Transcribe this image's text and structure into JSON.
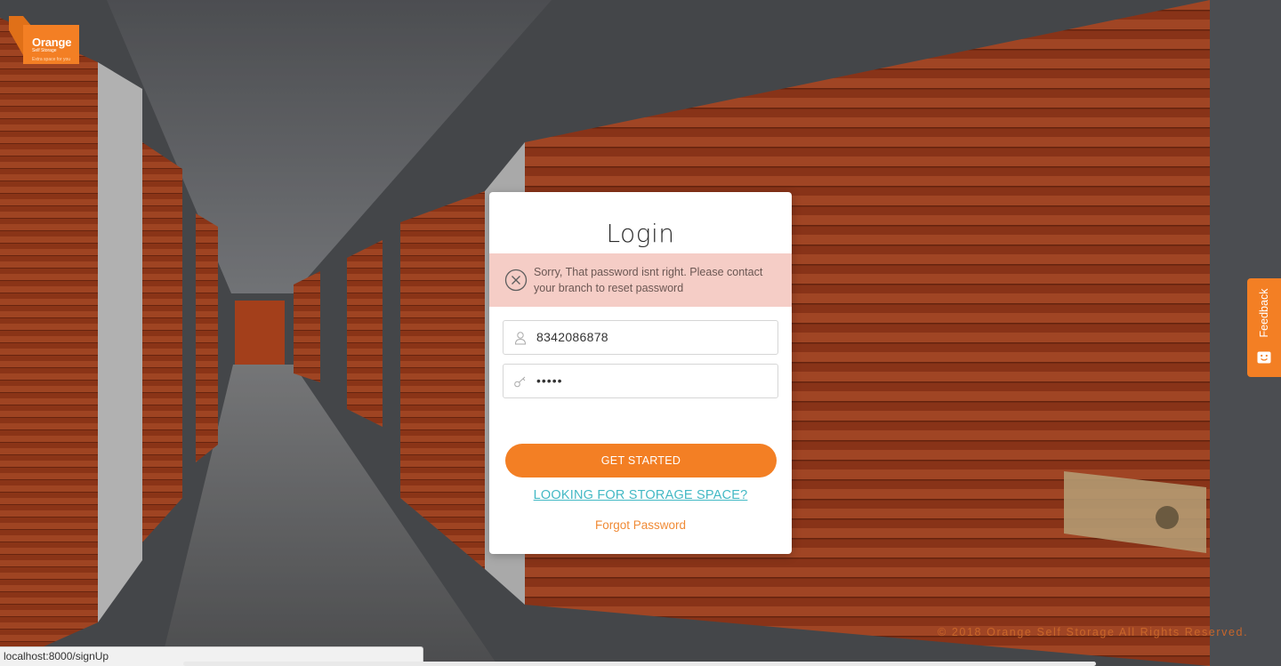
{
  "logo": {
    "brand": "Orange",
    "sub": "Self Storage",
    "tagline": "Extra space for you"
  },
  "login": {
    "title": "Login",
    "alert": {
      "icon": "close-circle-icon",
      "message": "Sorry, That password isnt right. Please contact your branch to reset password"
    },
    "username": {
      "icon": "user-icon",
      "value": "8342086878"
    },
    "password": {
      "icon": "key-icon",
      "masked_value": "•••••"
    },
    "submit_label": "GET STARTED",
    "storage_link": "LOOKING FOR STORAGE SPACE?",
    "forgot_link": "Forgot Password"
  },
  "feedback": {
    "label": "Feedback",
    "icon": "smiley-icon"
  },
  "footer": {
    "copyright": "© 2018 Orange Self Storage All Rights Reserved."
  },
  "status_bar": {
    "url": "localhost:8000/signUp"
  },
  "colors": {
    "accent": "#f37f24",
    "link": "#43b9c5",
    "alert_bg": "#f5cdc6",
    "shutter": "#b84a22"
  }
}
